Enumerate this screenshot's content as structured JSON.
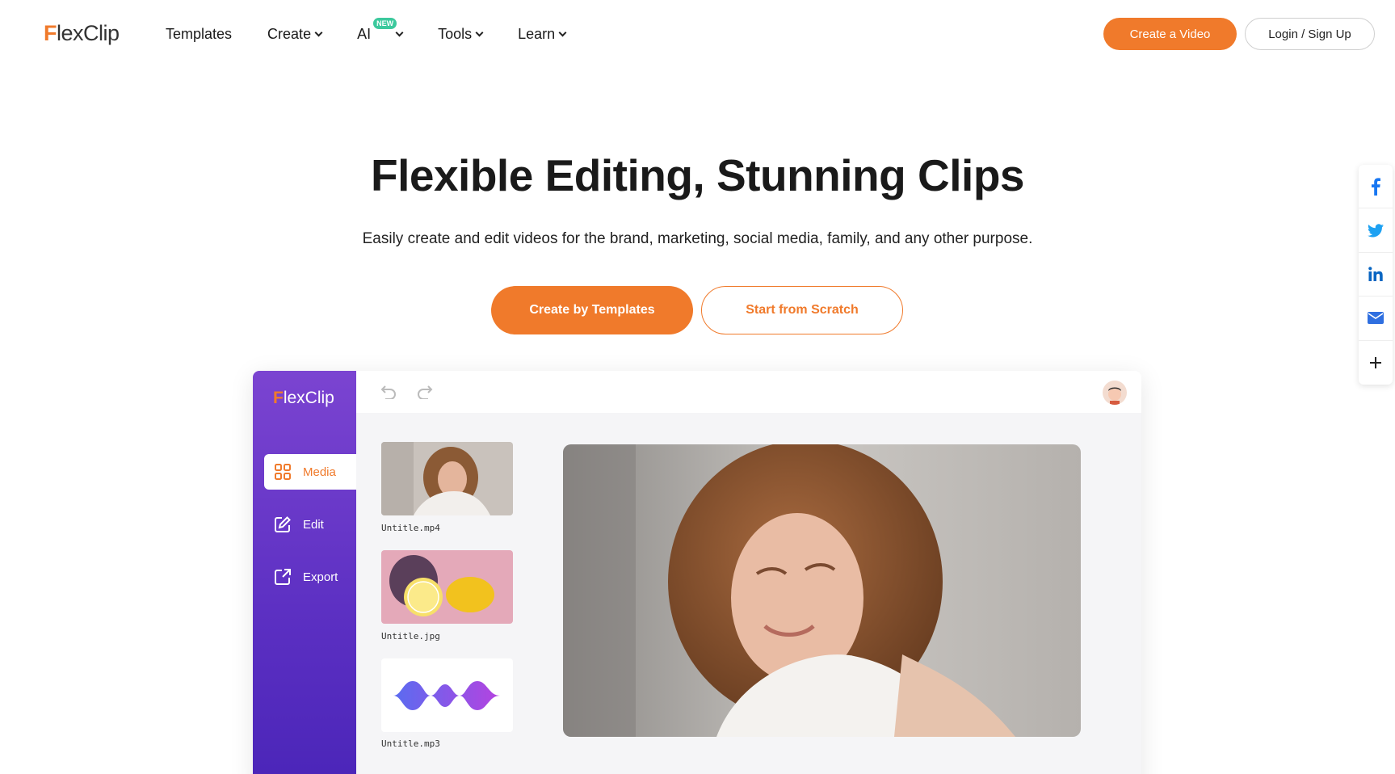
{
  "nav": {
    "logo": "lexClip",
    "logo_f": "F",
    "links": [
      "Templates",
      "Create",
      "AI",
      "Tools",
      "Learn"
    ],
    "ai_badge": "NEW",
    "create_video": "Create a Video",
    "login": "Login / Sign Up"
  },
  "hero": {
    "title": "Flexible Editing, Stunning Clips",
    "subtitle": "Easily create and edit videos for the brand, marketing, social media, family, and any other purpose.",
    "btn_templates": "Create by Templates",
    "btn_scratch": "Start from Scratch"
  },
  "share": {
    "icons": [
      "facebook-icon",
      "twitter-icon",
      "linkedin-icon",
      "email-icon",
      "plus-icon"
    ]
  },
  "mockup": {
    "logo": "lexClip",
    "logo_f": "F",
    "menu": [
      "Media",
      "Edit",
      "Export"
    ],
    "files": [
      "Untitle.mp4",
      "Untitle.jpg",
      "Untitle.mp3"
    ]
  },
  "colors": {
    "accent": "#f07a2b",
    "sidebar": "#5b2fc2",
    "new_badge": "#3cc99d"
  }
}
